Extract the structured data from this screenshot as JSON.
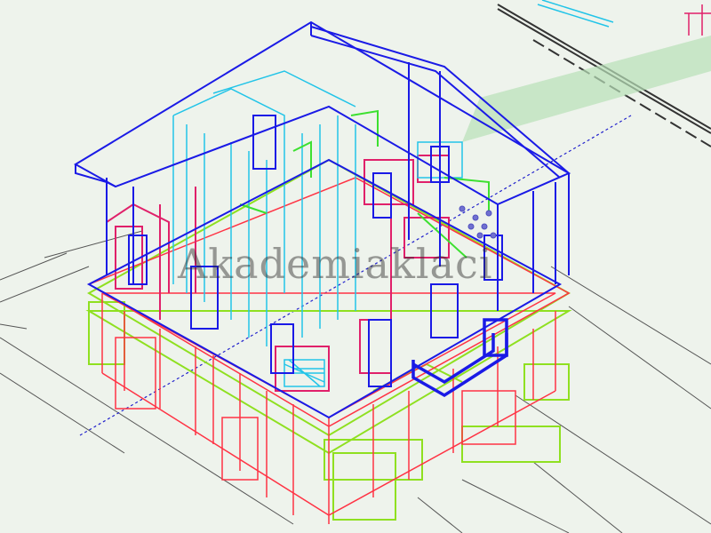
{
  "viewport": {
    "background": "#eef3ec",
    "watermark": "Akademiaklaci",
    "colors": {
      "roof_and_upper": "#1a1ae6",
      "interior_light": "#22c4e8",
      "ground_floor": "#ff3344",
      "magenta": "#e0206a",
      "foundation": "#8fe020",
      "green_highlight": "#3ce030",
      "ground_lines": "#555555",
      "axis_blue": "#2222cc",
      "site_shadow": "#b8e0b8"
    },
    "icons": {
      "corner_axis": "axis-icon"
    }
  }
}
